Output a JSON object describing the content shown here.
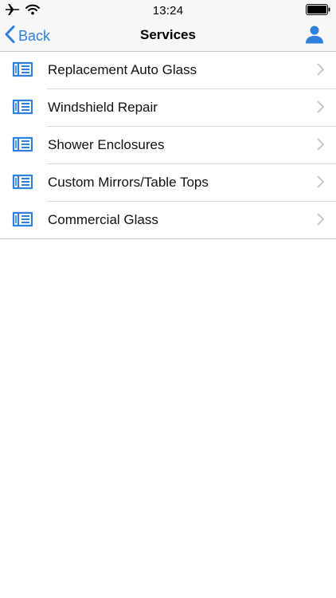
{
  "status_bar": {
    "time": "13:24",
    "icons": [
      "airplane-icon",
      "wifi-icon",
      "battery-icon"
    ]
  },
  "nav_bar": {
    "back_label": "Back",
    "title": "Services",
    "right_icon": "person-icon"
  },
  "colors": {
    "accent": "#2f7fde",
    "bar_background": "#f7f7f7",
    "separator": "#c8c7cc",
    "chevron": "#c7c7cc"
  },
  "services": [
    {
      "label": "Replacement Auto Glass",
      "icon": "catalog-icon"
    },
    {
      "label": "Windshield Repair",
      "icon": "catalog-icon"
    },
    {
      "label": "Shower Enclosures",
      "icon": "catalog-icon"
    },
    {
      "label": "Custom Mirrors/Table Tops",
      "icon": "catalog-icon"
    },
    {
      "label": "Commercial Glass",
      "icon": "catalog-icon"
    }
  ]
}
